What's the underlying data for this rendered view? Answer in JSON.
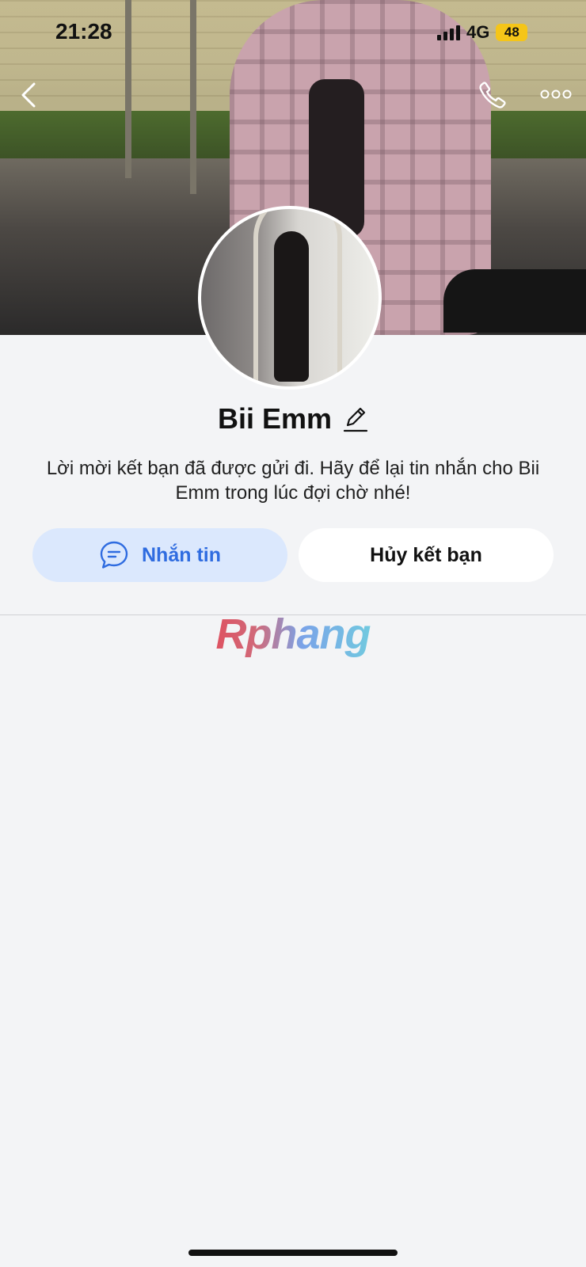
{
  "status_bar": {
    "time": "21:28",
    "network": "4G",
    "battery": "48"
  },
  "nav": {
    "back_icon": "chevron-left-icon",
    "call_icon": "phone-icon",
    "more_icon": "more-dots-icon"
  },
  "profile": {
    "name": "Bii Emm",
    "edit_icon": "pencil-icon",
    "message": "Lời mời kết bạn đã được gửi đi. Hãy để lại tin nhắn cho Bii Emm trong lúc đợi chờ nhé!"
  },
  "actions": {
    "message_label": "Nhắn tin",
    "message_icon": "chat-bubble-icon",
    "cancel_label": "Hủy kết bạn"
  },
  "watermark": "Rphang",
  "colors": {
    "accent": "#2f6ce0",
    "message_button_bg": "#dbe8fd",
    "background": "#f3f4f6",
    "battery": "#f5c518"
  }
}
